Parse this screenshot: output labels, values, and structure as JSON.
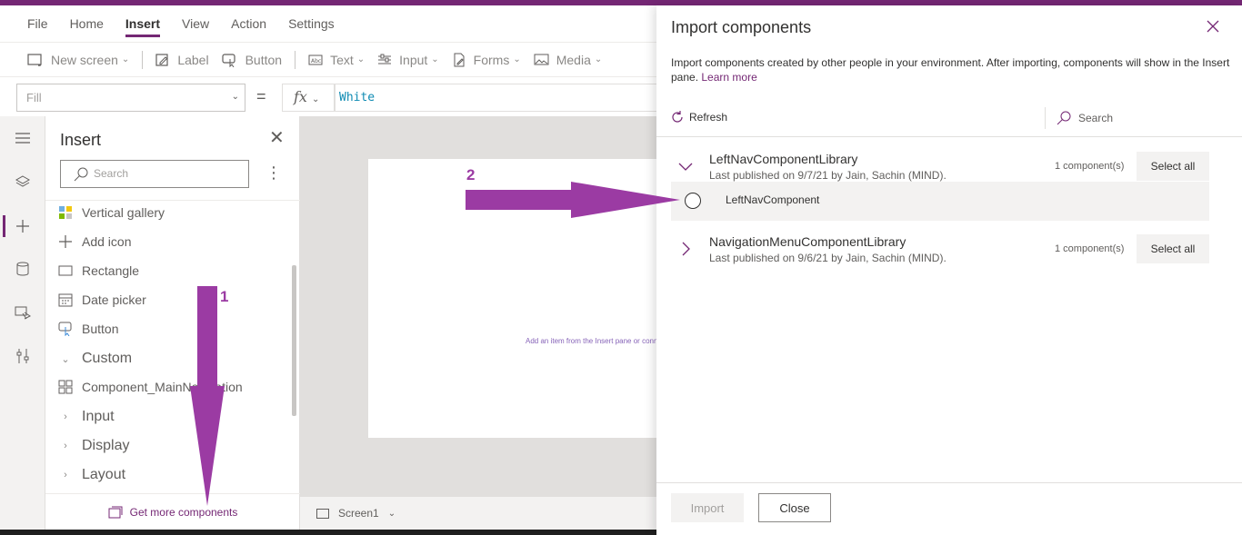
{
  "menu": {
    "items": [
      {
        "label": "File",
        "active": false
      },
      {
        "label": "Home",
        "active": false
      },
      {
        "label": "Insert",
        "active": true
      },
      {
        "label": "View",
        "active": false
      },
      {
        "label": "Action",
        "active": false
      },
      {
        "label": "Settings",
        "active": false
      }
    ]
  },
  "toolbar": {
    "new_screen": "New screen",
    "label": "Label",
    "button": "Button",
    "text": "Text",
    "input": "Input",
    "forms": "Forms",
    "media": "Media"
  },
  "formula": {
    "property": "Fill",
    "eq": "=",
    "fx": "fx",
    "value": "White"
  },
  "insert_pane": {
    "title": "Insert",
    "search_placeholder": "Search",
    "items": [
      {
        "label": "Vertical gallery",
        "icon": "gallery-icon"
      },
      {
        "label": "Add icon",
        "icon": "plus-icon"
      },
      {
        "label": "Rectangle",
        "icon": "rectangle-icon"
      },
      {
        "label": "Date picker",
        "icon": "calendar-icon"
      },
      {
        "label": "Button",
        "icon": "button-icon"
      }
    ],
    "custom_label": "Custom",
    "custom_item": "Component_MainNavigation",
    "categories": [
      "Input",
      "Display",
      "Layout"
    ],
    "get_more": "Get more components"
  },
  "canvas": {
    "hint": "Add an item from the Insert pane or connect to data"
  },
  "statusbar": {
    "screen": "Screen1"
  },
  "annotations": {
    "arrow1": "1",
    "arrow2": "2",
    "color": "#9b3ba3"
  },
  "import_panel": {
    "title": "Import components",
    "description": "Import components created by other people in your environment. After importing, components will show in the Insert pane.",
    "learn_more": "Learn more",
    "refresh": "Refresh",
    "search": "Search",
    "libraries": [
      {
        "name": "LeftNavComponentLibrary",
        "published": "Last published on 9/7/21 by Jain, Sachin (MIND).",
        "count": "1 component(s)",
        "select_all": "Select all",
        "expanded": true,
        "components": [
          "LeftNavComponent"
        ]
      },
      {
        "name": "NavigationMenuComponentLibrary",
        "published": "Last published on 9/6/21 by Jain, Sachin (MIND).",
        "count": "1 component(s)",
        "select_all": "Select all",
        "expanded": false
      }
    ],
    "import_button": "Import",
    "close_button": "Close"
  },
  "colors": {
    "brand": "#742774",
    "annotation": "#9b3ba3"
  }
}
